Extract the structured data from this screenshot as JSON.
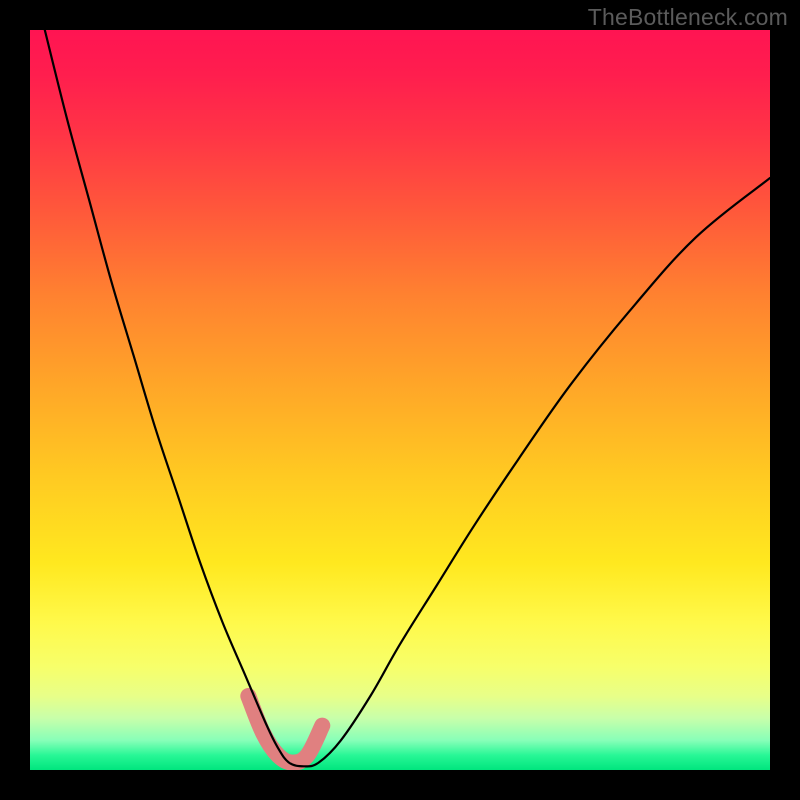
{
  "attribution": "TheBottleneck.com",
  "chart_data": {
    "type": "line",
    "title": "",
    "xlabel": "",
    "ylabel": "",
    "xlim": [
      0,
      100
    ],
    "ylim": [
      0,
      100
    ],
    "series": [
      {
        "name": "bottleneck-curve",
        "x": [
          2,
          5,
          8,
          11,
          14,
          17,
          20,
          23,
          26,
          29,
          32,
          33.5,
          35,
          37,
          39,
          42,
          46,
          50,
          55,
          60,
          66,
          73,
          81,
          90,
          100
        ],
        "values": [
          100,
          88,
          77,
          66,
          56,
          46,
          37,
          28,
          20,
          13,
          6,
          3,
          1,
          0.5,
          1,
          4,
          10,
          17,
          25,
          33,
          42,
          52,
          62,
          72,
          80
        ]
      }
    ],
    "markers": {
      "name": "highlight-segment",
      "x": [
        29.5,
        31.5,
        33.5,
        35.5,
        37.5,
        39.5
      ],
      "values": [
        10,
        5,
        2,
        1,
        2,
        6
      ]
    },
    "colors": {
      "curve": "#000000",
      "marker": "#e08080",
      "gradient_top": "#ff1452",
      "gradient_bottom": "#00e57e"
    }
  }
}
